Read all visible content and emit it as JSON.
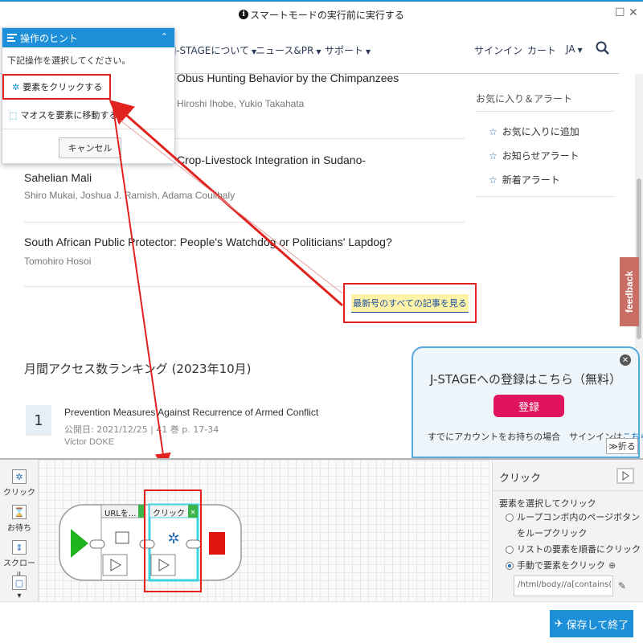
{
  "window": {
    "title": "スマートモードの実行前に実行する",
    "info_icon": "i",
    "restore_icon": "☐",
    "close_icon": "✕"
  },
  "navbar": {
    "items": [
      {
        "label": "J-STAGEについて"
      },
      {
        "label": "ニュース&PR"
      },
      {
        "label": "サポート"
      }
    ],
    "signin": "サインイン",
    "cart": "カート",
    "lang": "JA"
  },
  "articles": [
    {
      "title": "Obus Hunting Behavior by the Chimpanzees",
      "authors": "Hiroshi Ihobe, Yukio Takahata"
    },
    {
      "title": "Crop-Livestock Integration in Sudano-",
      "title2": "Sahelian Mali",
      "authors": "Shiro Mukai, Joshua J. Ramish, Adama Coulibaly"
    },
    {
      "title": "South African Public Protector: People's Watchdog or Politicians' Lapdog?",
      "authors": "Tomohiro Hosoi"
    }
  ],
  "sidebar": {
    "title": "お気に入り＆アラート",
    "links": [
      "お気に入りに追加",
      "お知らせアラート",
      "新着アラート"
    ]
  },
  "feedback": "feedback",
  "all_articles": "最新号のすべての記事を見る",
  "ranking": {
    "title": "月間アクセス数ランキング (2023年10月)",
    "items": [
      {
        "rank": "1",
        "title": "Prevention Measures Against Recurrence of Armed Conflict",
        "meta": "公開日: 2021/12/25 | 41 巻 p. 17-34",
        "author": "Victor DOKE"
      }
    ]
  },
  "register": {
    "title": "J-STAGEへの登録はこちら（無料）",
    "button": "登録",
    "text": "すでにアカウントをお持ちの場合　サインインは",
    "link": "こちら",
    "fold": "折る",
    "close": "✕"
  },
  "hint": {
    "header": "操作のヒント",
    "subtitle": "下記操作を選択してください。",
    "item1": "要素をクリックする",
    "item2": "マオスを要素に移動する",
    "cancel": "キャンセル"
  },
  "toolbox": {
    "tools": [
      {
        "label": "クリック"
      },
      {
        "label": "お待ち"
      },
      {
        "label": "スクロール"
      }
    ]
  },
  "workflow": {
    "node1_label": "URLを...",
    "node2_label": "クリック"
  },
  "props": {
    "title": "クリック",
    "label": "要素を選択してクリック",
    "options": [
      {
        "text": "ループコンボ内のページボタンをループクリック",
        "selected": false
      },
      {
        "text": "リストの要素を順番にクリック",
        "selected": false
      },
      {
        "text": "手動で要素をクリック",
        "selected": true
      }
    ],
    "xpath": "/html/body//a[contains(co"
  },
  "footer": {
    "save": "保存して終了"
  },
  "colors": {
    "accent": "#1c8fd8",
    "highlight_red": "#e0231f",
    "register_pink": "#e0145c",
    "feedback": "#c86e65"
  }
}
